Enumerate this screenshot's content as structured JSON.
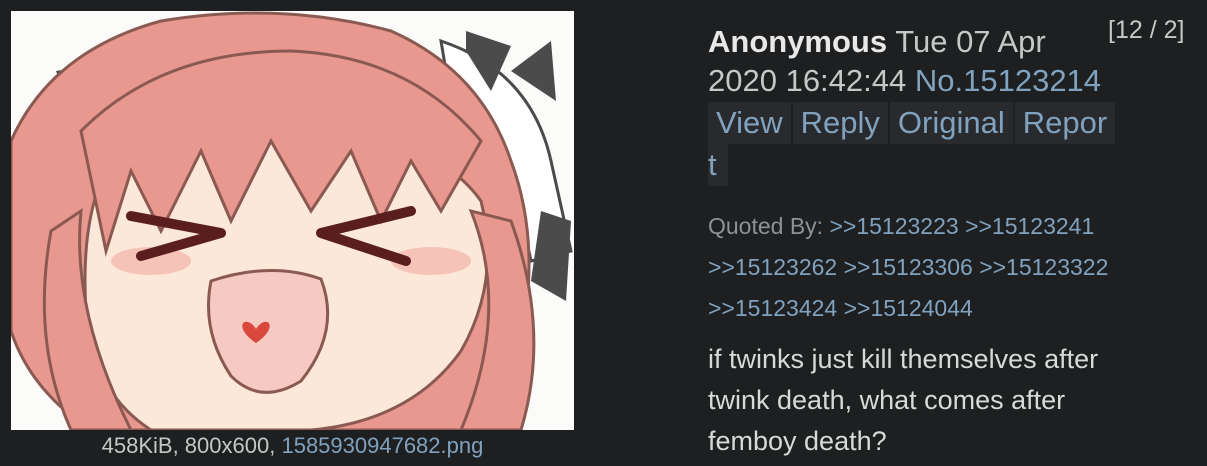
{
  "post": {
    "counter": "[12 / 2]",
    "name": "Anonymous",
    "datetime_line1": "Tue 07 Apr",
    "datetime_line2": "2020 16:42:44",
    "post_number": "No.15123214",
    "menu": {
      "view": "View",
      "reply": "Reply",
      "original": "Original",
      "report_a": "Repor",
      "report_b": "t"
    },
    "quoted_by_label": "Quoted By:",
    "quotes": [
      ">>15123223",
      ">>15123241",
      ">>15123262",
      ">>15123306",
      ">>15123322",
      ">>15123424",
      ">>15124044"
    ],
    "comment_lines": [
      "if twinks just kill themselves after",
      "twink death, what comes after",
      "femboy death?"
    ]
  },
  "file": {
    "meta": "458KiB, 800x600,",
    "filename": "1585930947682.png"
  },
  "colors": {
    "background": "#1d1f21",
    "link": "#81a2be",
    "hair": "#e8988f"
  }
}
